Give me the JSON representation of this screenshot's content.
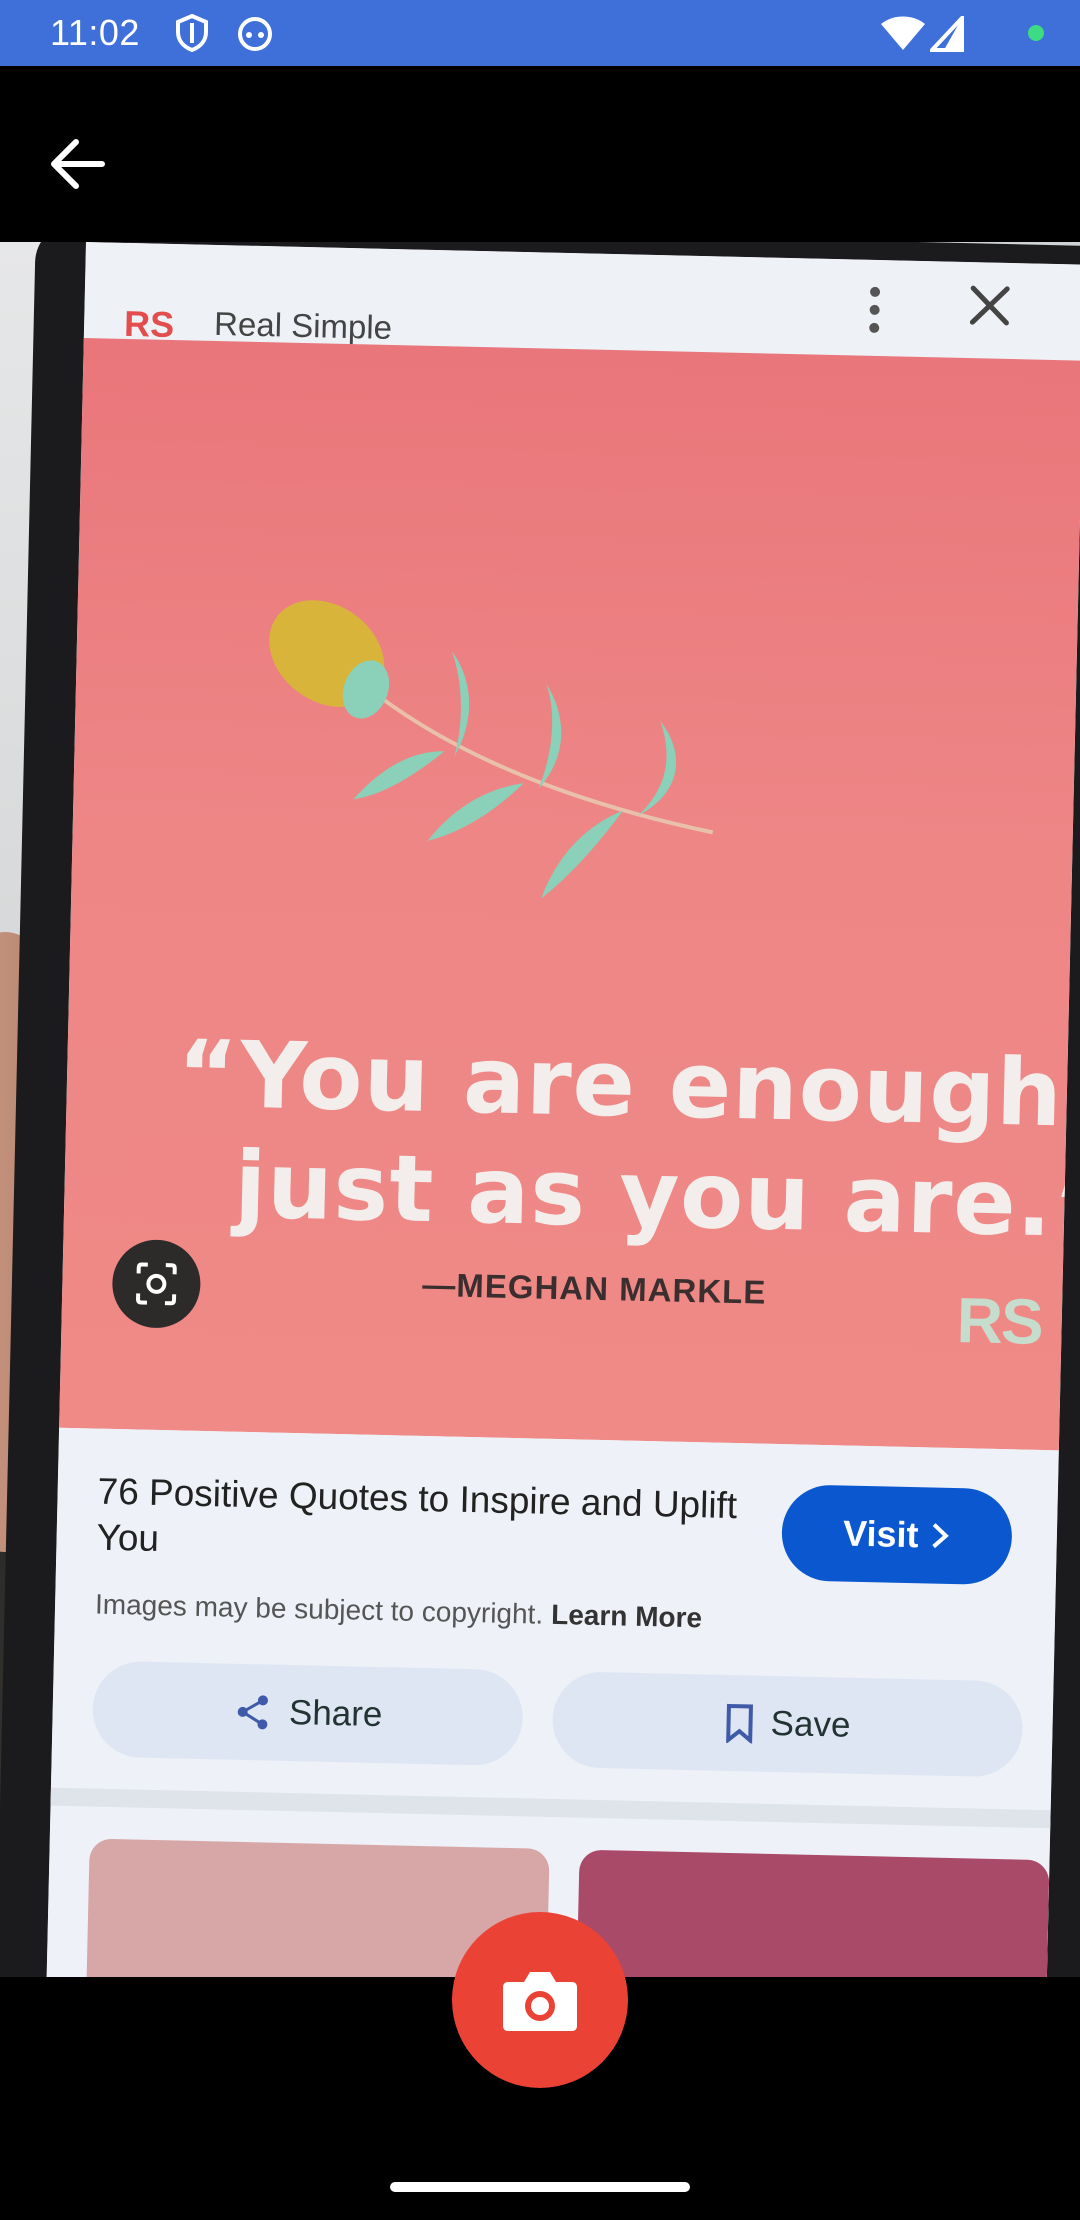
{
  "status_bar": {
    "time": "11:02",
    "icons": [
      "shield-icon",
      "cat-icon",
      "wifi-icon",
      "signal-icon",
      "green-dot-icon"
    ],
    "background_color": "#3f6fd8"
  },
  "app_bar": {
    "back_icon": "arrow-left-icon"
  },
  "viewfinder": {
    "sheet": {
      "logo": "RS",
      "site_name": "Real Simple",
      "more_icon": "more-vertical-icon",
      "close_icon": "close-icon"
    },
    "quote_image": {
      "quote_line_1": "“You are enough",
      "quote_line_2": "just as you are.”",
      "attribution": "—MEGHAN MARKLE",
      "watermark": "RS",
      "lens_icon": "lens-icon",
      "background_color": "#ee8686"
    },
    "result": {
      "title": "76 Positive Quotes to Inspire and Uplift You",
      "visit_label": "Visit",
      "copyright_text": "Images may be subject to copyright.",
      "learn_more": "Learn More",
      "share_label": "Share",
      "save_label": "Save",
      "accent_color": "#0b57d0"
    }
  },
  "camera": {
    "shutter_icon": "camera-icon",
    "shutter_color": "#ea4335"
  }
}
